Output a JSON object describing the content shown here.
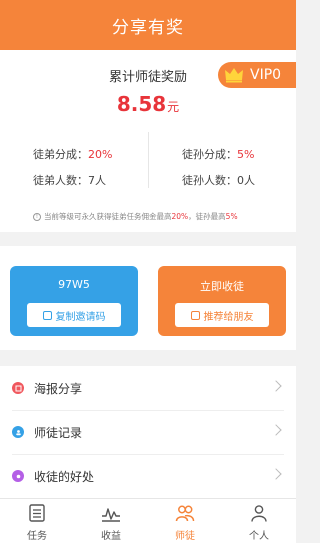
{
  "header": {
    "title": "分享有奖"
  },
  "summary": {
    "title": "累计师徒奖励",
    "amount": "8.58",
    "unit": "元",
    "vip_label": "VIP0",
    "stats": {
      "disciple_share_label": "徒弟分成：",
      "disciple_share_value": "20%",
      "grand_disciple_share_label": "徒孙分成：",
      "grand_disciple_share_value": "5%",
      "disciple_count_label": "徒弟人数：",
      "disciple_count_value": "7人",
      "grand_disciple_count_label": "徒孙人数：",
      "grand_disciple_count_value": "0人"
    },
    "note": {
      "prefix": "当前等级可永久获得徒弟任务佣金最高",
      "disciple_pct": "20%",
      "middle": "，徒孙最高",
      "grand_pct": "5%"
    }
  },
  "actions": {
    "invite_code": "97W5",
    "copy_button": "复制邀请码",
    "collect_title": "立即收徒",
    "recommend_button": "推荐给朋友"
  },
  "menu": {
    "items": [
      {
        "label": "海报分享"
      },
      {
        "label": "师徒记录"
      },
      {
        "label": "收徒的好处"
      }
    ]
  },
  "tabbar": {
    "tabs": [
      {
        "label": "任务"
      },
      {
        "label": "收益"
      },
      {
        "label": "师徒"
      },
      {
        "label": "个人"
      }
    ],
    "active": "师徒"
  },
  "colors": {
    "accent": "#f5843a",
    "blue": "#35a1e6",
    "red": "#e8343a"
  }
}
